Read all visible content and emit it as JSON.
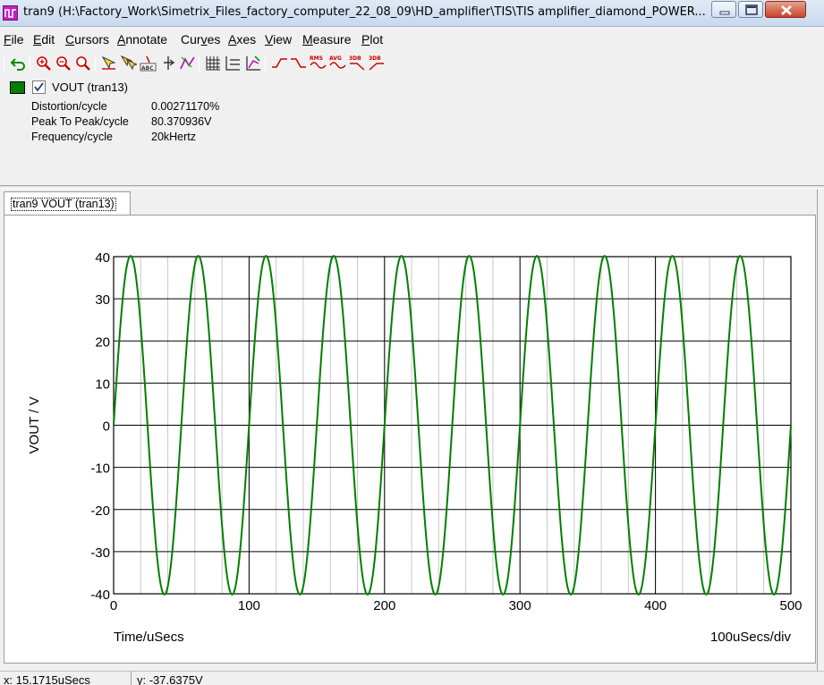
{
  "window": {
    "title": "tran9 (H:\\Factory_Work\\Simetrix_Files_factory_computer_22_08_09\\HD_amplifier\\TIS\\TIS amplifier_diamond_POWER...",
    "app_icon": "waveform-icon",
    "controls": [
      "minimize-icon",
      "maximize-icon",
      "close-icon"
    ]
  },
  "menu": {
    "items": [
      {
        "mnemonic": "F",
        "rest": "ile"
      },
      {
        "mnemonic": "E",
        "rest": "dit"
      },
      {
        "mnemonic": "C",
        "rest": "ursors"
      },
      {
        "mnemonic": "A",
        "rest": "nnotate"
      },
      {
        "mnemonic": "C",
        "rest": "ur",
        "mnemonic2": "v",
        "rest2": "es"
      },
      {
        "mnemonic": "A",
        "rest": "xes"
      },
      {
        "mnemonic": "V",
        "rest": "iew"
      },
      {
        "mnemonic": "M",
        "rest": "easure"
      },
      {
        "mnemonic": "P",
        "rest": "lot"
      }
    ]
  },
  "toolbar": {
    "icons": [
      "undo-icon",
      "zoom-in-icon",
      "zoom-out-icon",
      "zoom-fit-icon",
      "cursor-icon",
      "cursor-pair-icon",
      "label-icon",
      "bar-align-icon",
      "curve-edit-icon",
      "grid-icon",
      "separate-axes-icon",
      "axes-zoom-icon",
      "rise-edge-icon",
      "fall-edge-icon",
      "rms-icon",
      "avg-icon",
      "3db-low-icon",
      "3db-high-icon"
    ],
    "rms_text": "RMS",
    "avg_text": "AVG",
    "db_text": "3DB"
  },
  "legend": {
    "color": "#008000",
    "checked": true,
    "label": "VOUT (tran13)",
    "measurements": [
      {
        "label": "Distortion/cycle",
        "value": "0.00271170%"
      },
      {
        "label": "Peak To Peak/cycle",
        "value": "80.370936V"
      },
      {
        "label": "Frequency/cycle",
        "value": "20kHertz"
      }
    ]
  },
  "tab": {
    "label": "tran9 VOUT (tran13)"
  },
  "chart_data": {
    "type": "line",
    "series": [
      {
        "name": "VOUT (tran13)",
        "color": "#008000",
        "frequency_hz": 20000,
        "amplitude": 40.18,
        "phase_deg": 0,
        "start_us": 0,
        "end_us": 500
      }
    ],
    "xlabel": "Time/uSecs",
    "ylabel": "VOUT / V",
    "xlim": [
      0,
      500
    ],
    "ylim": [
      -40,
      40
    ],
    "x_major_ticks": [
      0,
      100,
      200,
      300,
      400,
      500
    ],
    "x_minor_step": 20,
    "y_ticks": [
      40,
      30,
      20,
      10,
      0,
      -10,
      -20,
      -30,
      -40
    ],
    "x_div_label": "100uSecs/div",
    "grid": true
  },
  "status": {
    "x": "x: 15.1715uSecs",
    "y": "y: -37.6375V"
  }
}
